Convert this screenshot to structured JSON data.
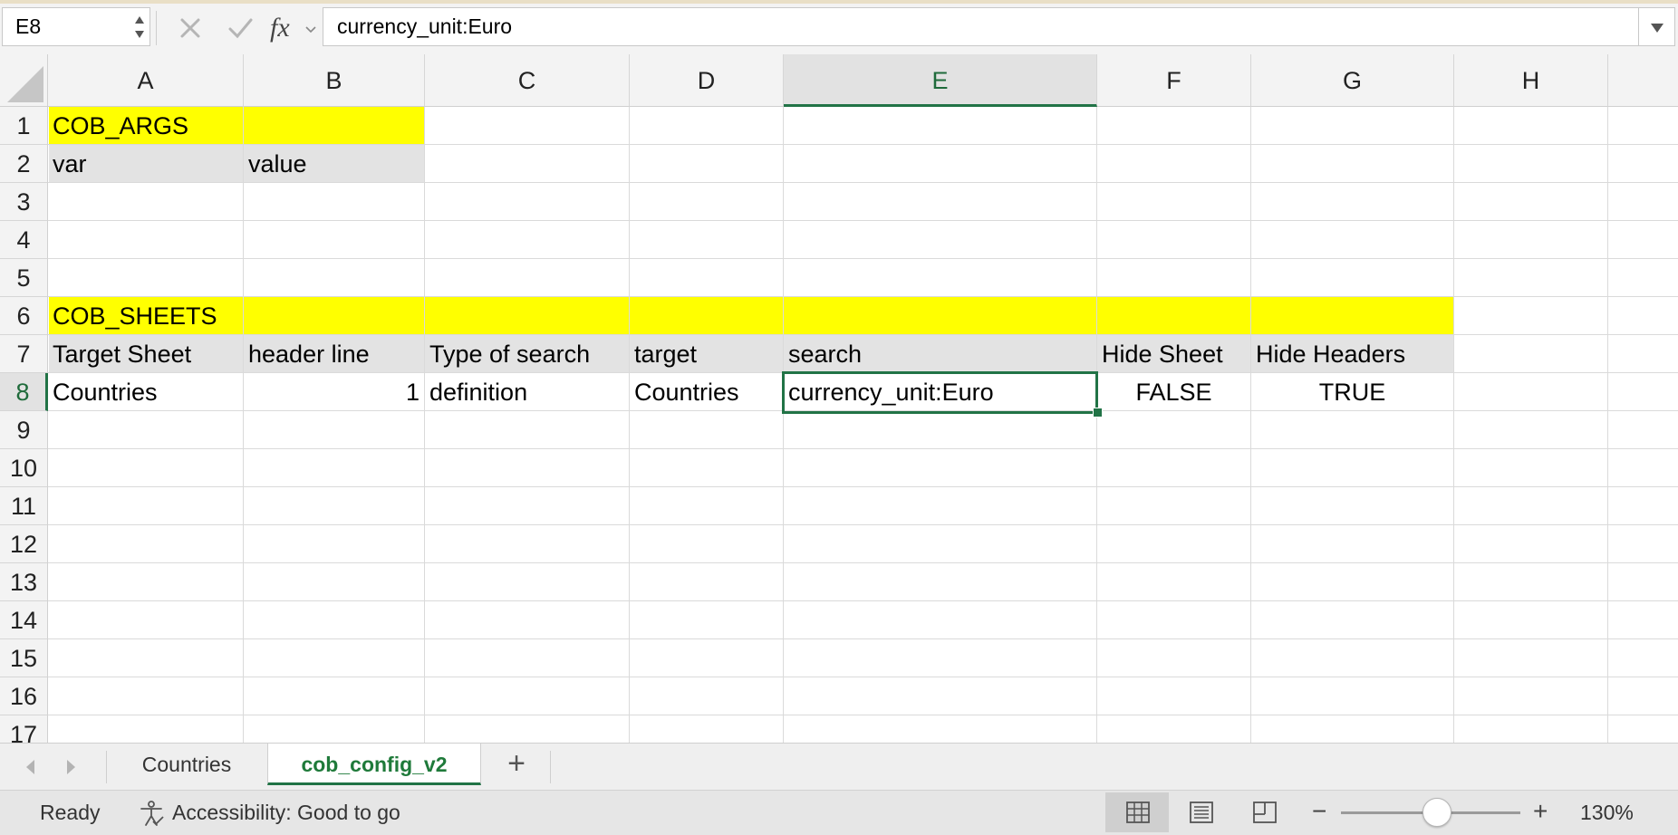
{
  "formula_bar": {
    "name_box": "E8",
    "fx_label": "fx",
    "formula": "currency_unit:Euro"
  },
  "grid": {
    "columns": [
      "A",
      "B",
      "C",
      "D",
      "E",
      "F",
      "G",
      "H"
    ],
    "selected_column": "E",
    "rows": [
      "1",
      "2",
      "3",
      "4",
      "5",
      "6",
      "7",
      "8",
      "9",
      "10",
      "11",
      "12",
      "13",
      "14",
      "15",
      "16",
      "17"
    ],
    "selected_row": "8",
    "section_args": {
      "title": "COB_ARGS",
      "headers": [
        "var",
        "value"
      ]
    },
    "section_sheets": {
      "title": "COB_SHEETS",
      "headers": [
        "Target Sheet",
        "header line",
        "Type of search",
        "target",
        "search",
        "Hide Sheet",
        "Hide Headers"
      ],
      "row": [
        "Countries",
        "1",
        "definition",
        "Countries",
        "currency_unit:Euro",
        "FALSE",
        "TRUE"
      ]
    },
    "colors": {
      "section_fill": "#ffff00",
      "header_fill": "#e3e3e3",
      "selection": "#217346"
    }
  },
  "sheet_tabs": {
    "tabs": [
      "Countries",
      "cob_config_v2"
    ],
    "active": "cob_config_v2",
    "add_label": "+"
  },
  "status_bar": {
    "ready": "Ready",
    "accessibility": "Accessibility: Good to go",
    "zoom": "130%",
    "zoom_out_label": "−",
    "zoom_in_label": "+"
  }
}
